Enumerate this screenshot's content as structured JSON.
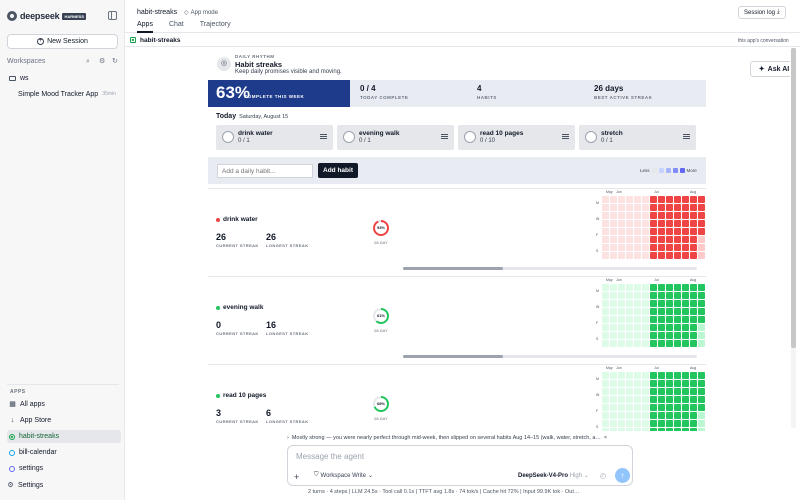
{
  "sidebar": {
    "logo_text": "deepseek",
    "logo_badge": "HARNESS",
    "new_session": "New Session",
    "workspaces_label": "Workspaces",
    "workspace_name": "ws",
    "session_name": "Simple Mood Tracker App",
    "session_time": "35min",
    "apps_label": "APPS",
    "items": [
      {
        "label": "All apps",
        "icon": "grid-icon"
      },
      {
        "label": "App Store",
        "icon": "download-icon"
      },
      {
        "label": "habit-streaks",
        "icon": "app-icon"
      },
      {
        "label": "bill-calendar",
        "icon": "app-icon"
      },
      {
        "label": "settings",
        "icon": "app-icon"
      }
    ],
    "settings": "Settings"
  },
  "topbar": {
    "title": "habit-streaks",
    "app_mode": "App mode",
    "tabs": [
      "Apps",
      "Chat",
      "Trajectory"
    ],
    "session_log": "Session log"
  },
  "subbar": {
    "title": "habit-streaks",
    "right": "this app's conversation"
  },
  "app": {
    "eyebrow": "DAILY RHYTHM",
    "title": "Habit streaks",
    "subtitle": "Keep daily promises visible and moving.",
    "ask_ai": "Ask AI",
    "stats": {
      "week_pct": "63%",
      "week_label": "COMPLETE THIS WEEK",
      "today_val": "0 / 4",
      "today_label": "TODAY COMPLETE",
      "habits_val": "4",
      "habits_label": "HABITS",
      "best_val": "26 days",
      "best_label": "BEST ACTIVE STREAK"
    },
    "today_label": "Today",
    "today_date": "Saturday, August 15",
    "cards": [
      {
        "name": "drink water",
        "count": "0 / 1"
      },
      {
        "name": "evening walk",
        "count": "0 / 1"
      },
      {
        "name": "read 10 pages",
        "count": "0 / 10"
      },
      {
        "name": "stretch",
        "count": "0 / 1"
      }
    ],
    "add_placeholder": "Add a daily habit...",
    "add_button": "Add habit",
    "legend_less": "Less",
    "legend_more": "More",
    "heat_months": [
      "May",
      "Jun",
      "Jul",
      "Aug"
    ],
    "heat_days": [
      "M",
      "W",
      "F",
      "S"
    ],
    "current_label": "CURRENT STREAK",
    "longest_label": "LONGEST STREAK",
    "ring_suffix": "28-DAY",
    "habits": [
      {
        "name": "drink water",
        "current": "26",
        "longest": "26",
        "pct": "93%",
        "ring": 0.93,
        "color": "#ef4444",
        "light": "#fecaca",
        "empty": "#e5e7eb"
      },
      {
        "name": "evening walk",
        "current": "0",
        "longest": "16",
        "pct": "61%",
        "ring": 0.61,
        "color": "#22c55e",
        "light": "#bbf7d0",
        "empty": "#e5e7eb"
      },
      {
        "name": "read 10 pages",
        "current": "3",
        "longest": "6",
        "pct": "68%",
        "ring": 0.68,
        "color": "#22c55e",
        "light": "#bbf7d0",
        "empty": "#e5e7eb"
      }
    ]
  },
  "chat": {
    "notice": "Mostly strong — you were nearly perfect through mid-week, then slipped on several habits Aug 14–15 (walk, water, stretch, a…",
    "placeholder": "Message the agent",
    "workspace": "Workspace Write",
    "model": "DeepSeek-V4-Pro",
    "model_level": "High",
    "footer": "2 turns · 4 steps  |  LLM 24.5s · Tool call 0.1s  |  TTFT avg 1.8s · 74 tok/s  |  Cache hit 72%  |  Input 99.9K tok · Out…"
  }
}
